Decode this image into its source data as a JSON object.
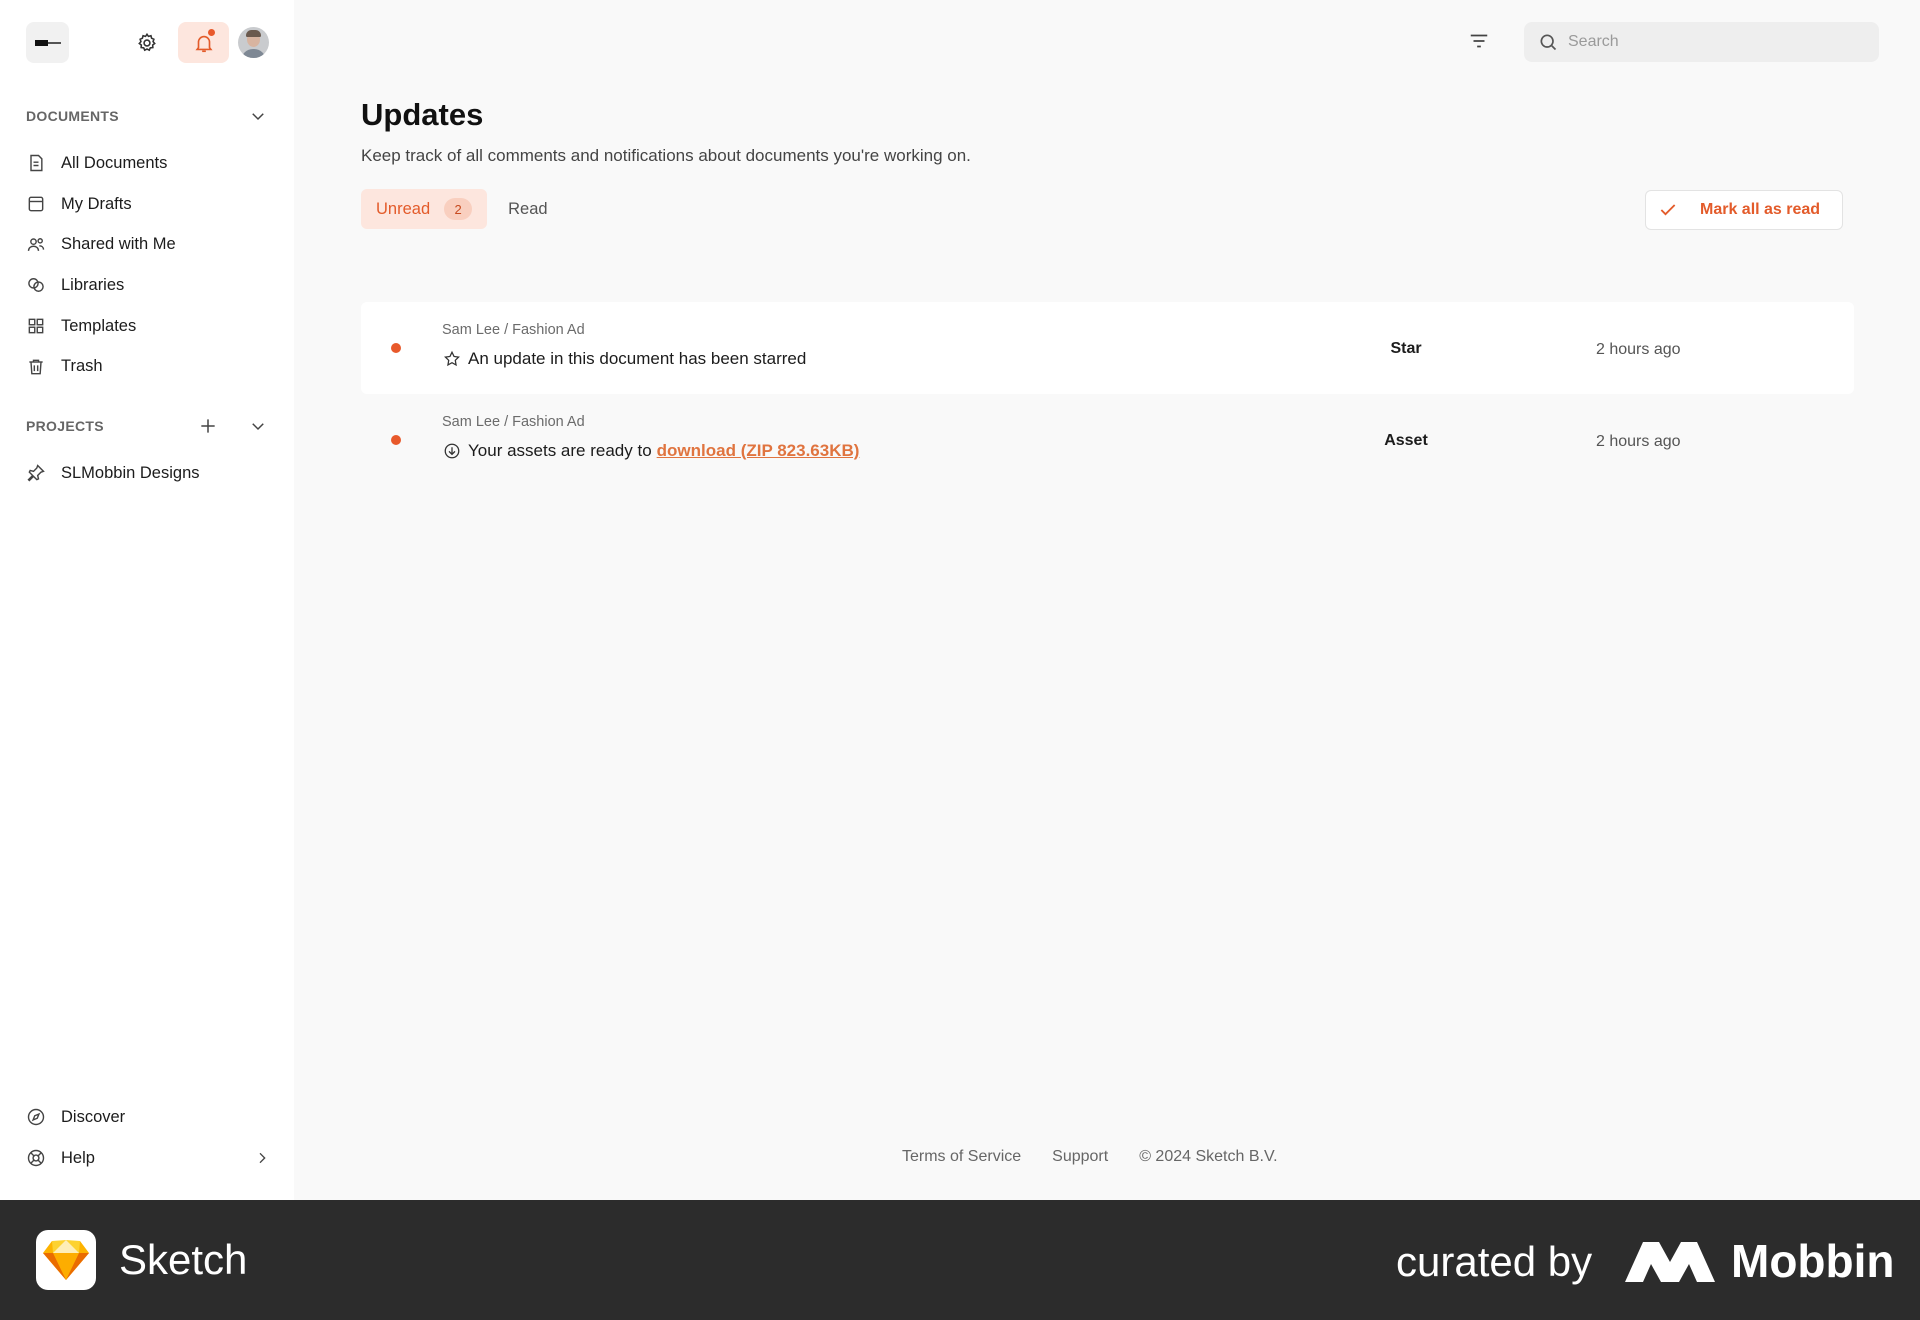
{
  "sidebar": {
    "documents_title": "DOCUMENTS",
    "documents": [
      {
        "label": "All Documents",
        "icon": "document-icon"
      },
      {
        "label": "My Drafts",
        "icon": "drafts-icon"
      },
      {
        "label": "Shared with Me",
        "icon": "people-icon"
      },
      {
        "label": "Libraries",
        "icon": "libraries-icon"
      },
      {
        "label": "Templates",
        "icon": "templates-icon"
      },
      {
        "label": "Trash",
        "icon": "trash-icon"
      }
    ],
    "projects_title": "PROJECTS",
    "projects": [
      {
        "label": "SLMobbin Designs",
        "icon": "pin-icon"
      }
    ],
    "bottom": [
      {
        "label": "Discover",
        "icon": "compass-icon"
      },
      {
        "label": "Help",
        "icon": "lifebuoy-icon"
      }
    ]
  },
  "header": {
    "search_placeholder": "Search"
  },
  "page": {
    "title": "Updates",
    "subtitle": "Keep track of all comments and notifications about documents you're working on.",
    "tabs": [
      {
        "label": "Unread",
        "count": "2",
        "active": true
      },
      {
        "label": "Read",
        "active": false
      }
    ],
    "mark_all_label": "Mark all as read"
  },
  "updates": [
    {
      "crumb": "Sam Lee / Fashion Ad",
      "message": "An update in this document has been starred",
      "icon": "star-icon",
      "type": "Star",
      "time": "2 hours ago",
      "unread": true
    },
    {
      "crumb": "Sam Lee / Fashion Ad",
      "message": "Your assets are ready to",
      "link": "download (ZIP 823.63KB)",
      "icon": "download-icon",
      "type": "Asset",
      "time": "2 hours ago",
      "unread": true
    }
  ],
  "footer": {
    "terms": "Terms of Service",
    "support": "Support",
    "copyright": "© 2024 Sketch B.V."
  },
  "brand": {
    "app_name": "Sketch",
    "curated_by": "curated by",
    "mobbin": "Mobbin"
  },
  "colors": {
    "accent": "#e35b2a",
    "accent_bg": "#fde6de",
    "unread_dot": "#e8592b",
    "brandbar": "#2c2c2c"
  }
}
